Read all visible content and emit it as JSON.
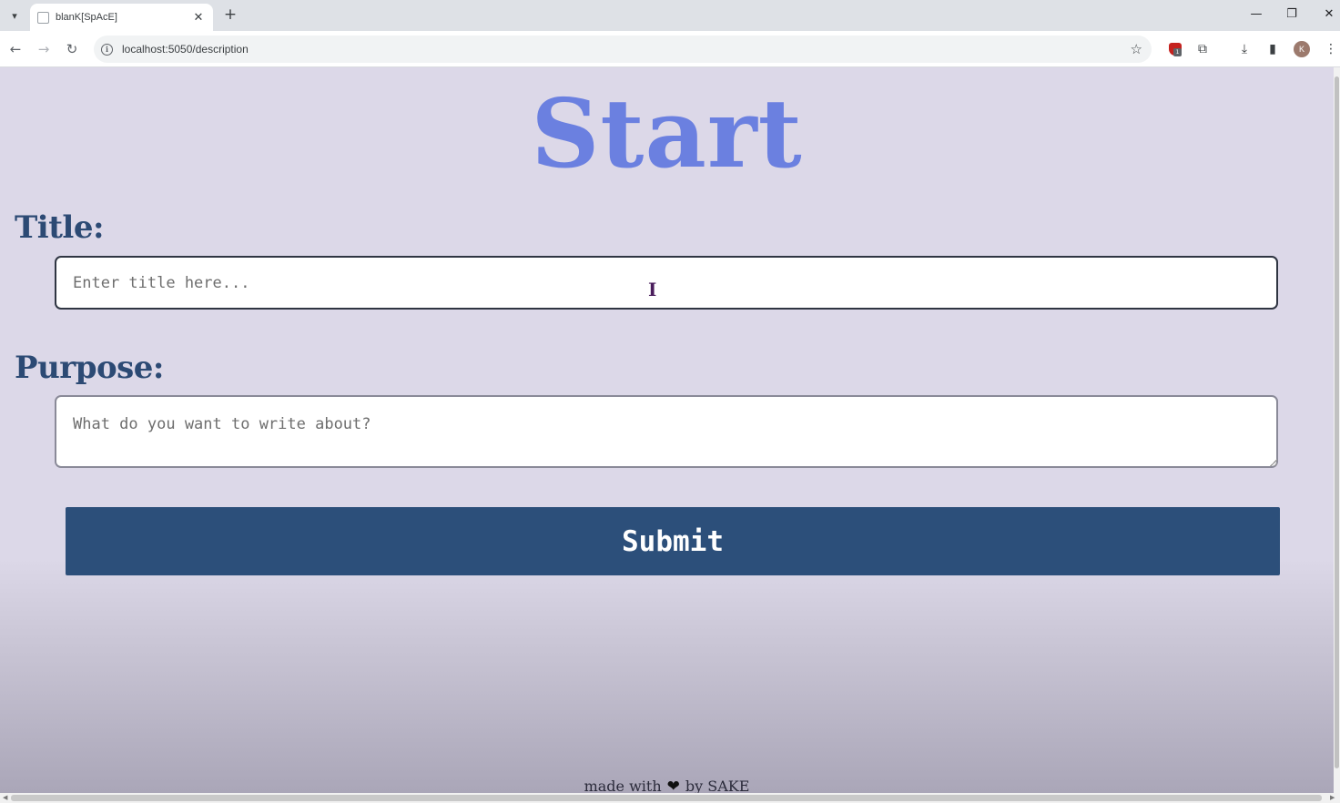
{
  "browser": {
    "tab_title": "blanK[SpAcE]",
    "tab_close": "✕",
    "new_tab": "+",
    "url": "localhost:5050/description",
    "profile_initial": "K",
    "extension_badge": "1"
  },
  "page": {
    "heading": "Start",
    "title_label": "Title:",
    "title_placeholder": "Enter title here...",
    "purpose_label": "Purpose:",
    "purpose_placeholder": "What do you want to write about?",
    "submit_label": "Submit",
    "footer_prefix": "made with",
    "footer_suffix": "by SAKE"
  },
  "colors": {
    "heading": "#6b80e0",
    "labels": "#2c4a74",
    "submit_bg": "#2c4f7a",
    "page_bg": "#dcd8e8"
  }
}
